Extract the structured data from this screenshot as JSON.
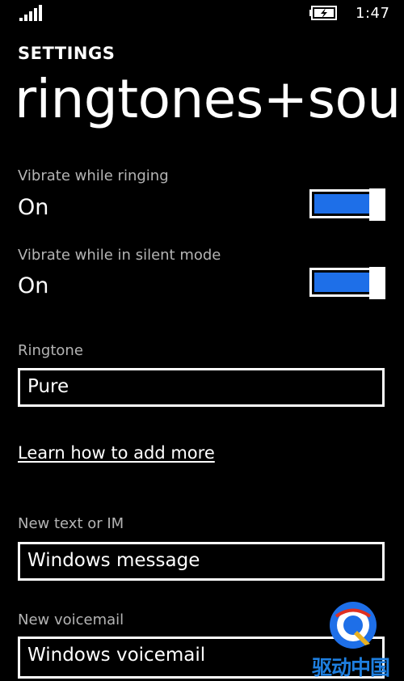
{
  "status_bar": {
    "time": "1:47",
    "signal_icon": "signal-bars-icon",
    "battery_icon": "battery-charging-icon"
  },
  "header": {
    "app_title": "SETTINGS",
    "page_title": "ringtones+sounds"
  },
  "settings": [
    {
      "label": "Vibrate while ringing",
      "value": "On",
      "state": true
    },
    {
      "label": "Vibrate while in silent mode",
      "value": "On",
      "state": true
    }
  ],
  "ringtone": {
    "label": "Ringtone",
    "value": "Pure"
  },
  "learn_link": "Learn how to add more",
  "new_text": {
    "label": "New text or IM",
    "value": "Windows message"
  },
  "new_voicemail": {
    "label": "New voicemail",
    "value": "Windows voicemail"
  },
  "watermark": {
    "text": "驱动中国"
  },
  "colors": {
    "background": "#000000",
    "accent": "#1e6fe8",
    "label": "#b4b4b4",
    "text": "#ffffff"
  }
}
